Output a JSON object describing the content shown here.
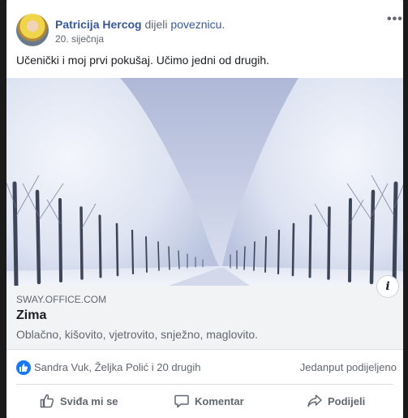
{
  "post": {
    "author": "Patricija Hercog",
    "action": "dijeli",
    "shared_what": "poveznicu.",
    "date": "20. siječnja",
    "more_icon": "more-horizontal-icon",
    "caption": "Učenički i moj prvi pokušaj. Učimo jedni od drugih."
  },
  "link": {
    "domain": "SWAY.OFFICE.COM",
    "title": "Zima",
    "description": "Oblačno, kišovito, vjetrovito, snježno, maglovito.",
    "info_icon": "info-icon",
    "info_glyph": "i"
  },
  "stats": {
    "reactors": "Sandra Vuk, Željka Polić i 20 drugih",
    "shares": "Jedanput podijeljeno"
  },
  "actions": {
    "like": "Sviđa mi se",
    "comment": "Komentar",
    "share": "Podijeli"
  },
  "colors": {
    "author": "#385898",
    "like_badge": "#1877f2",
    "muted_text": "#606770"
  }
}
